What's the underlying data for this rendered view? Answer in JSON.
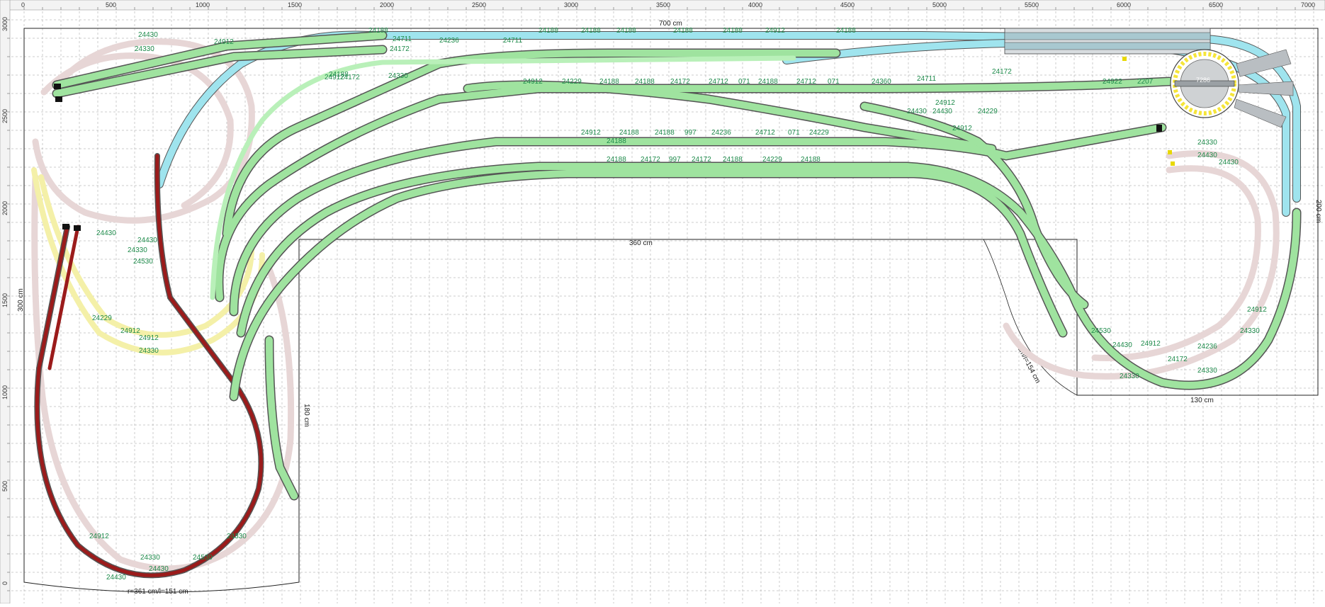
{
  "ruler": {
    "top_ticks": [
      "0",
      "500",
      "1000",
      "1500",
      "2000",
      "2500",
      "3000",
      "3500",
      "4000",
      "4500",
      "5000",
      "5500",
      "6000",
      "6500",
      "7000"
    ],
    "left_ticks": [
      "0",
      "500",
      "1000",
      "1500",
      "2000",
      "2500",
      "3000"
    ]
  },
  "dimensions": {
    "top_width": "700 cm",
    "inner_width": "360 cm",
    "left_height": "300 cm",
    "right_height": "200 cm",
    "inner_left_height": "180 cm",
    "bottom_right_width": "130 cm",
    "bottom_curve": "r=361 cm/l=151 cm",
    "right_curve": "r=8 cm/l=154 cm"
  },
  "turntable_label": "7286",
  "colors": {
    "grid": "#9a9a9a",
    "board": "#222222",
    "track_main": "#9fe39f",
    "track_cyan": "#9fe4ee",
    "track_pink": "#e7d6d6",
    "track_yellow": "#f4f0a8",
    "track_red": "#9b1b1b",
    "track_outline": "#555555",
    "label_green": "#1d8a4a",
    "turntable": "#f5e53a"
  },
  "track_labels": [
    "24430",
    "24912",
    "24188",
    "24330",
    "24172",
    "24236",
    "24711",
    "24912",
    "24188",
    "24188",
    "24188",
    "24188",
    "24188",
    "24188",
    "24912",
    "24229",
    "24188",
    "24188",
    "24172",
    "24712",
    "071",
    "24188",
    "24712",
    "071",
    "24360",
    "24711",
    "24172",
    "24922",
    "2207",
    "24912",
    "24188",
    "24188",
    "997",
    "24236",
    "24712",
    "071",
    "24229",
    "24188",
    "24188",
    "24172",
    "997",
    "24172",
    "24188",
    "24229",
    "24188",
    "24330",
    "24430",
    "24912",
    "24530",
    "24330",
    "24172",
    "24236",
    "24330",
    "24430",
    "24912",
    "24330",
    "24430",
    "24912",
    "24229",
    "24330",
    "24912",
    "24430",
    "24330",
    "24530",
    "24430",
    "24912",
    "24330",
    "24430",
    "24530",
    "24330",
    "24430",
    "24912",
    "24188",
    "24172",
    "24711",
    "24330",
    "24912",
    "24430",
    "24229",
    "24912",
    "24430"
  ]
}
